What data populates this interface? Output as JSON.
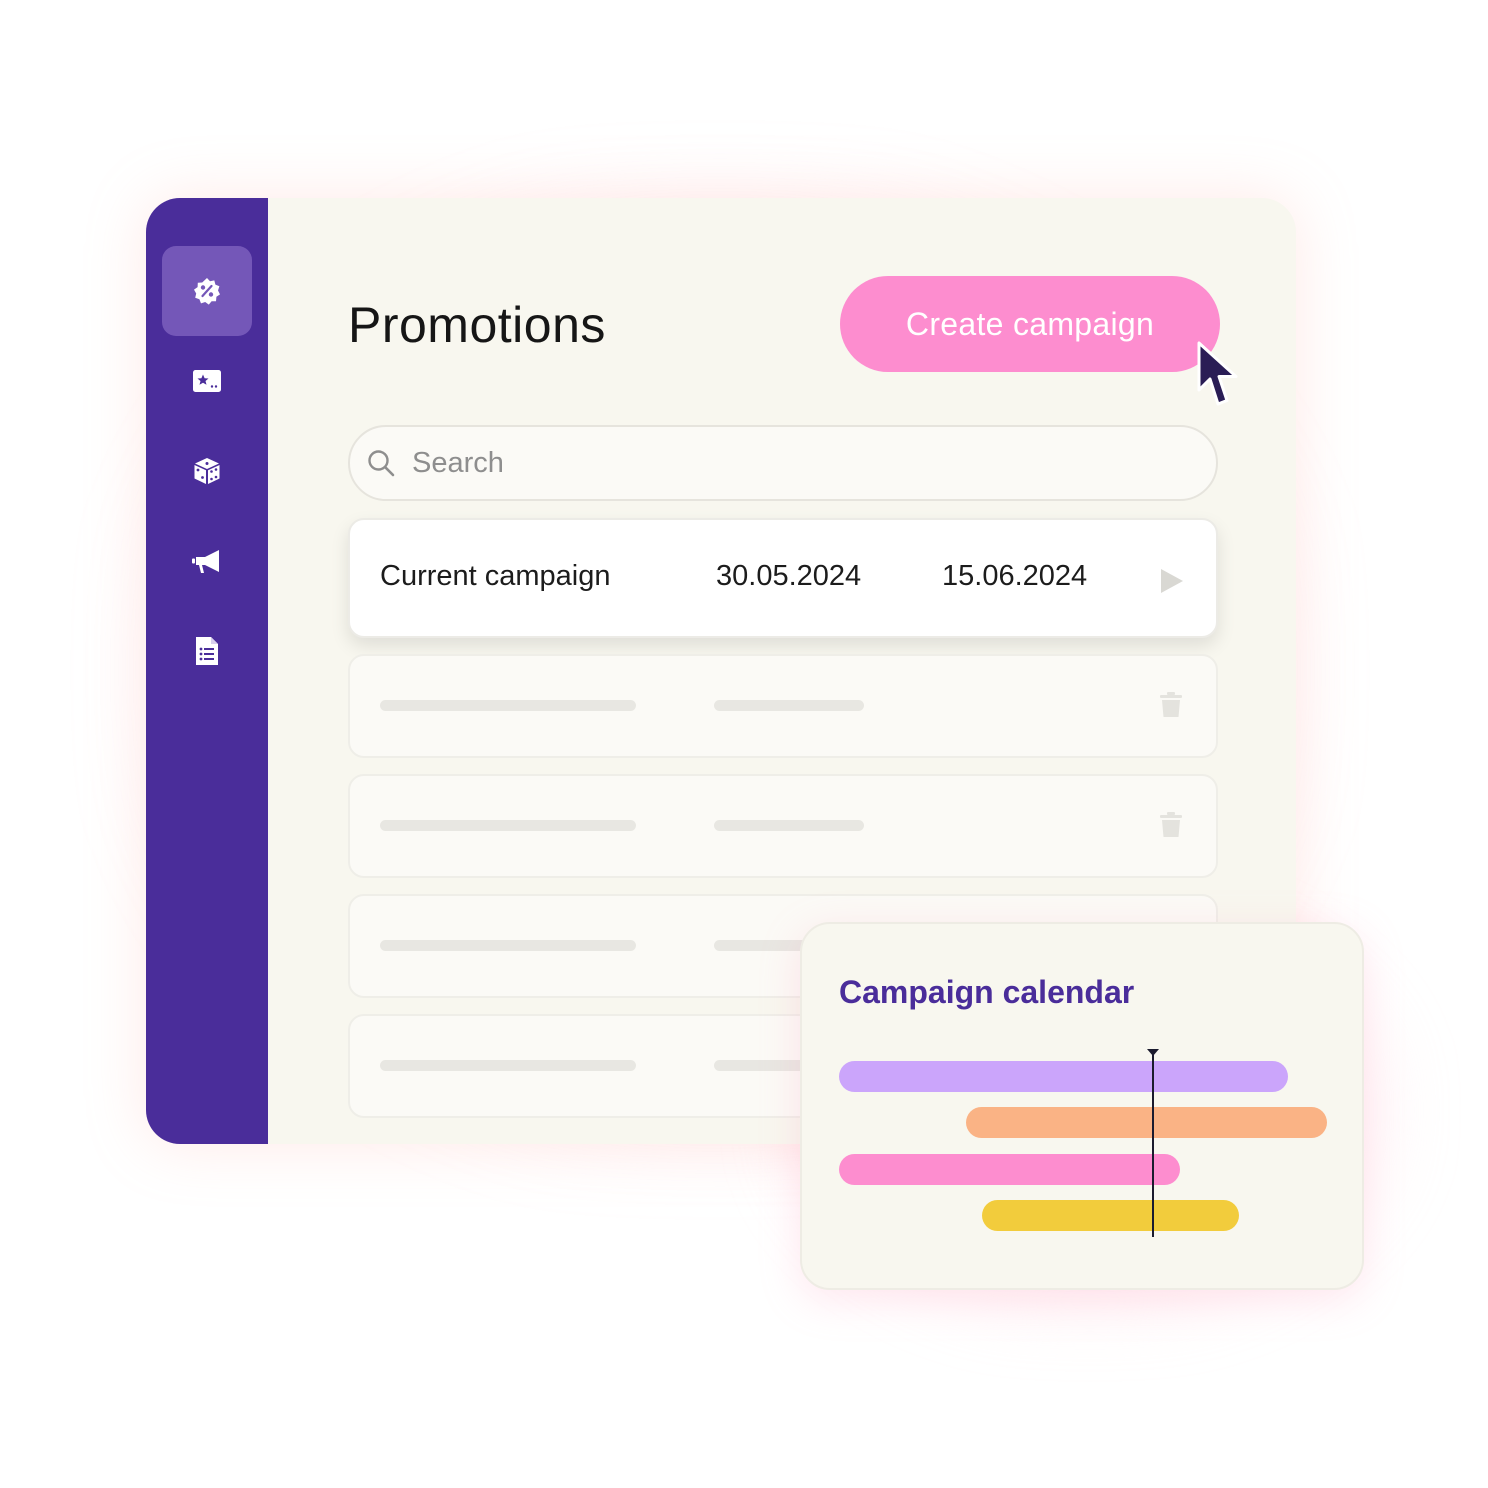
{
  "app": {
    "page_title": "Promotions",
    "create_button_label": "Create campaign"
  },
  "sidebar": {
    "items": [
      {
        "icon": "discount-badge-icon",
        "active": true
      },
      {
        "icon": "star-card-icon",
        "active": false
      },
      {
        "icon": "dice-icon",
        "active": false
      },
      {
        "icon": "megaphone-icon",
        "active": false
      },
      {
        "icon": "document-list-icon",
        "active": false
      }
    ]
  },
  "search": {
    "placeholder": "Search",
    "value": ""
  },
  "campaigns": {
    "current": {
      "name": "Current campaign",
      "start_date": "30.05.2024",
      "end_date": "15.06.2024"
    }
  },
  "calendar": {
    "title": "Campaign calendar",
    "bar_colors": [
      "#cba5fb",
      "#fab385",
      "#fd8dcf",
      "#f2cc3c"
    ]
  },
  "colors": {
    "sidebar": "#4a2d9a",
    "accent_pink": "#fd8dcf",
    "background": "#f8f7ef"
  }
}
